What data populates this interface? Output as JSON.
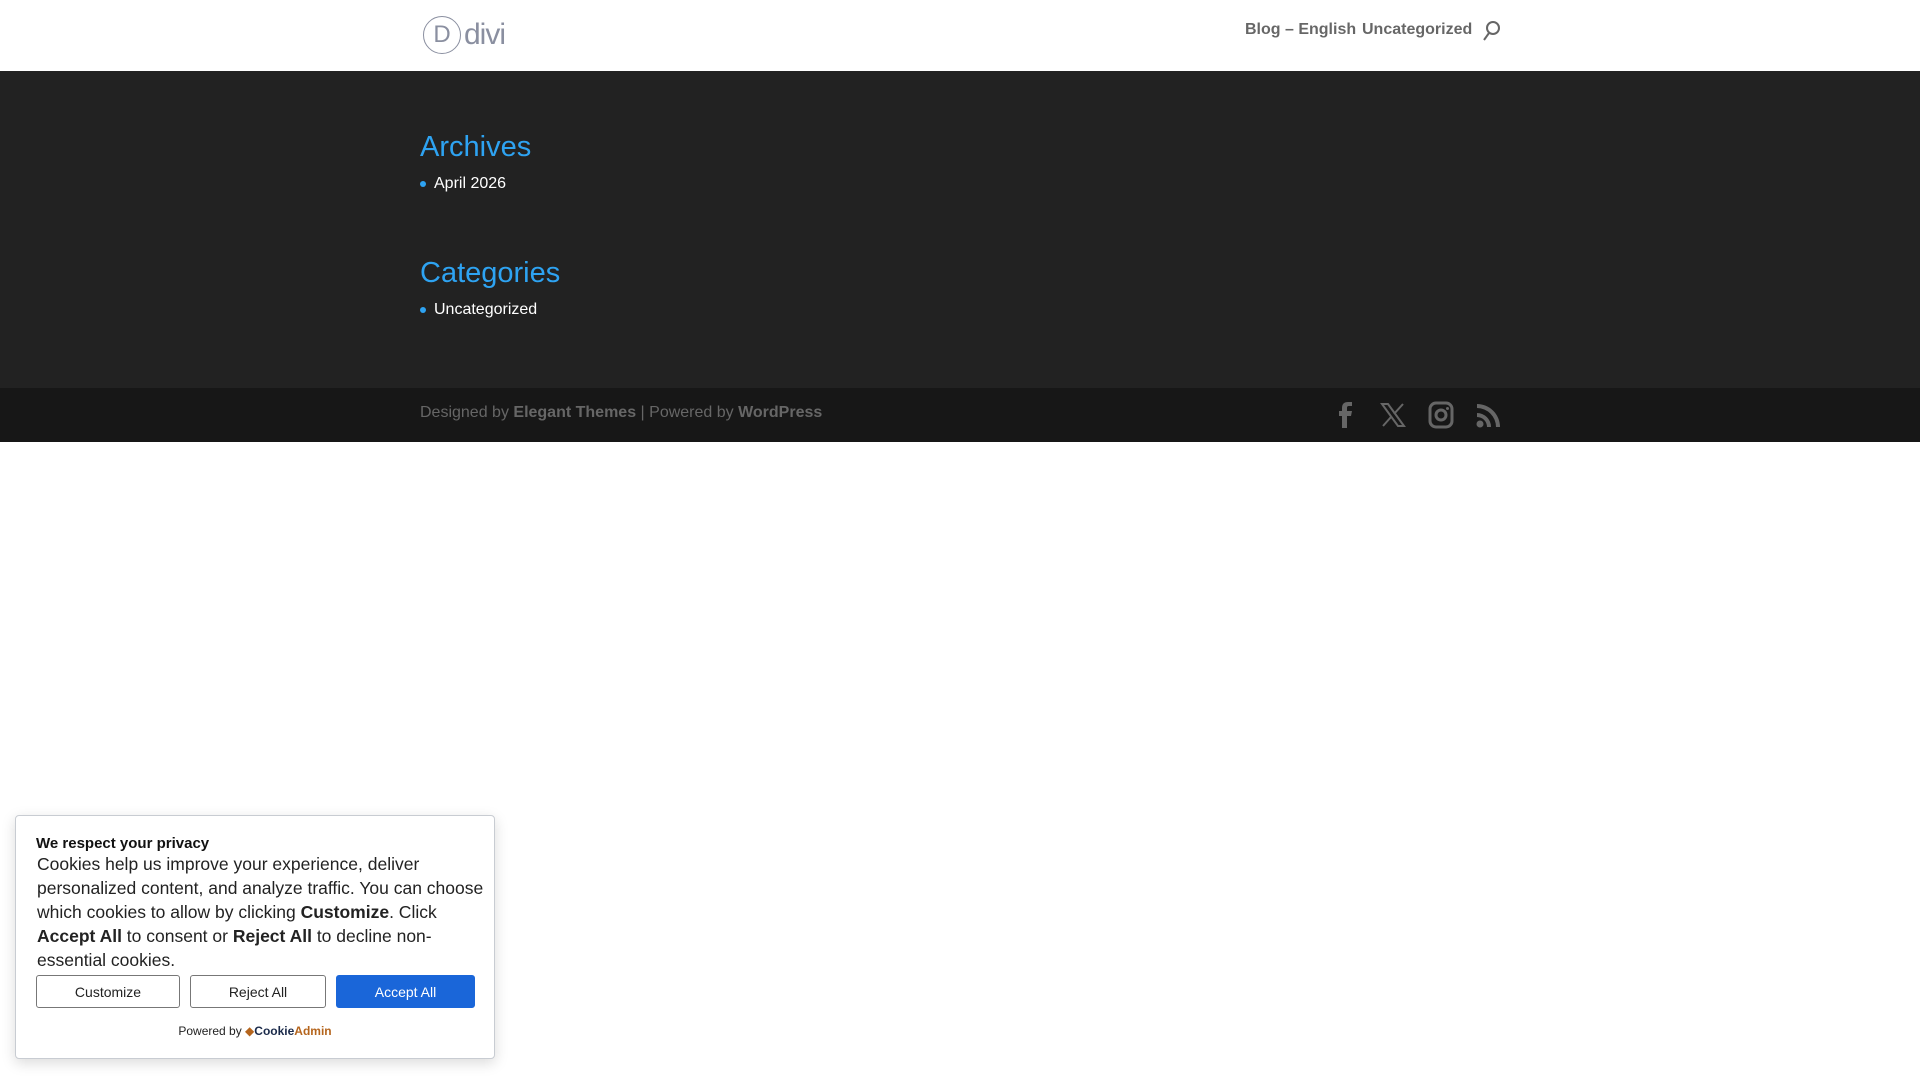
{
  "header": {
    "logo_letter": "D",
    "logo_word": "divi",
    "nav": [
      "Blog – English",
      "Uncategorized"
    ]
  },
  "main": {
    "archives": {
      "title": "Archives",
      "items": [
        "April 2026"
      ]
    },
    "categories": {
      "title": "Categories",
      "items": [
        "Uncategorized"
      ]
    }
  },
  "footer": {
    "designed_by": "Designed by ",
    "elegant": "Elegant Themes",
    "sep": " | Powered by ",
    "wordpress": "WordPress",
    "social": [
      "facebook-icon",
      "x-icon",
      "instagram-icon",
      "rss-icon"
    ]
  },
  "cookie": {
    "title": "We respect your privacy",
    "p1": "Cookies help us improve your experience, deliver personalized content, and analyze traffic. You can choose which cookies to allow by clicking ",
    "b1": "Customize",
    "p2": ". Click ",
    "b2": "Accept All",
    "p3": " to consent or ",
    "b3": "Reject All",
    "p4": " to decline non-essential cookies.",
    "customize": "Customize",
    "reject": "Reject All",
    "accept": "Accept All",
    "powered": "Powered by ",
    "brand_a": "Cookie",
    "brand_b": "Admin",
    "accent": "#1a66d9"
  }
}
